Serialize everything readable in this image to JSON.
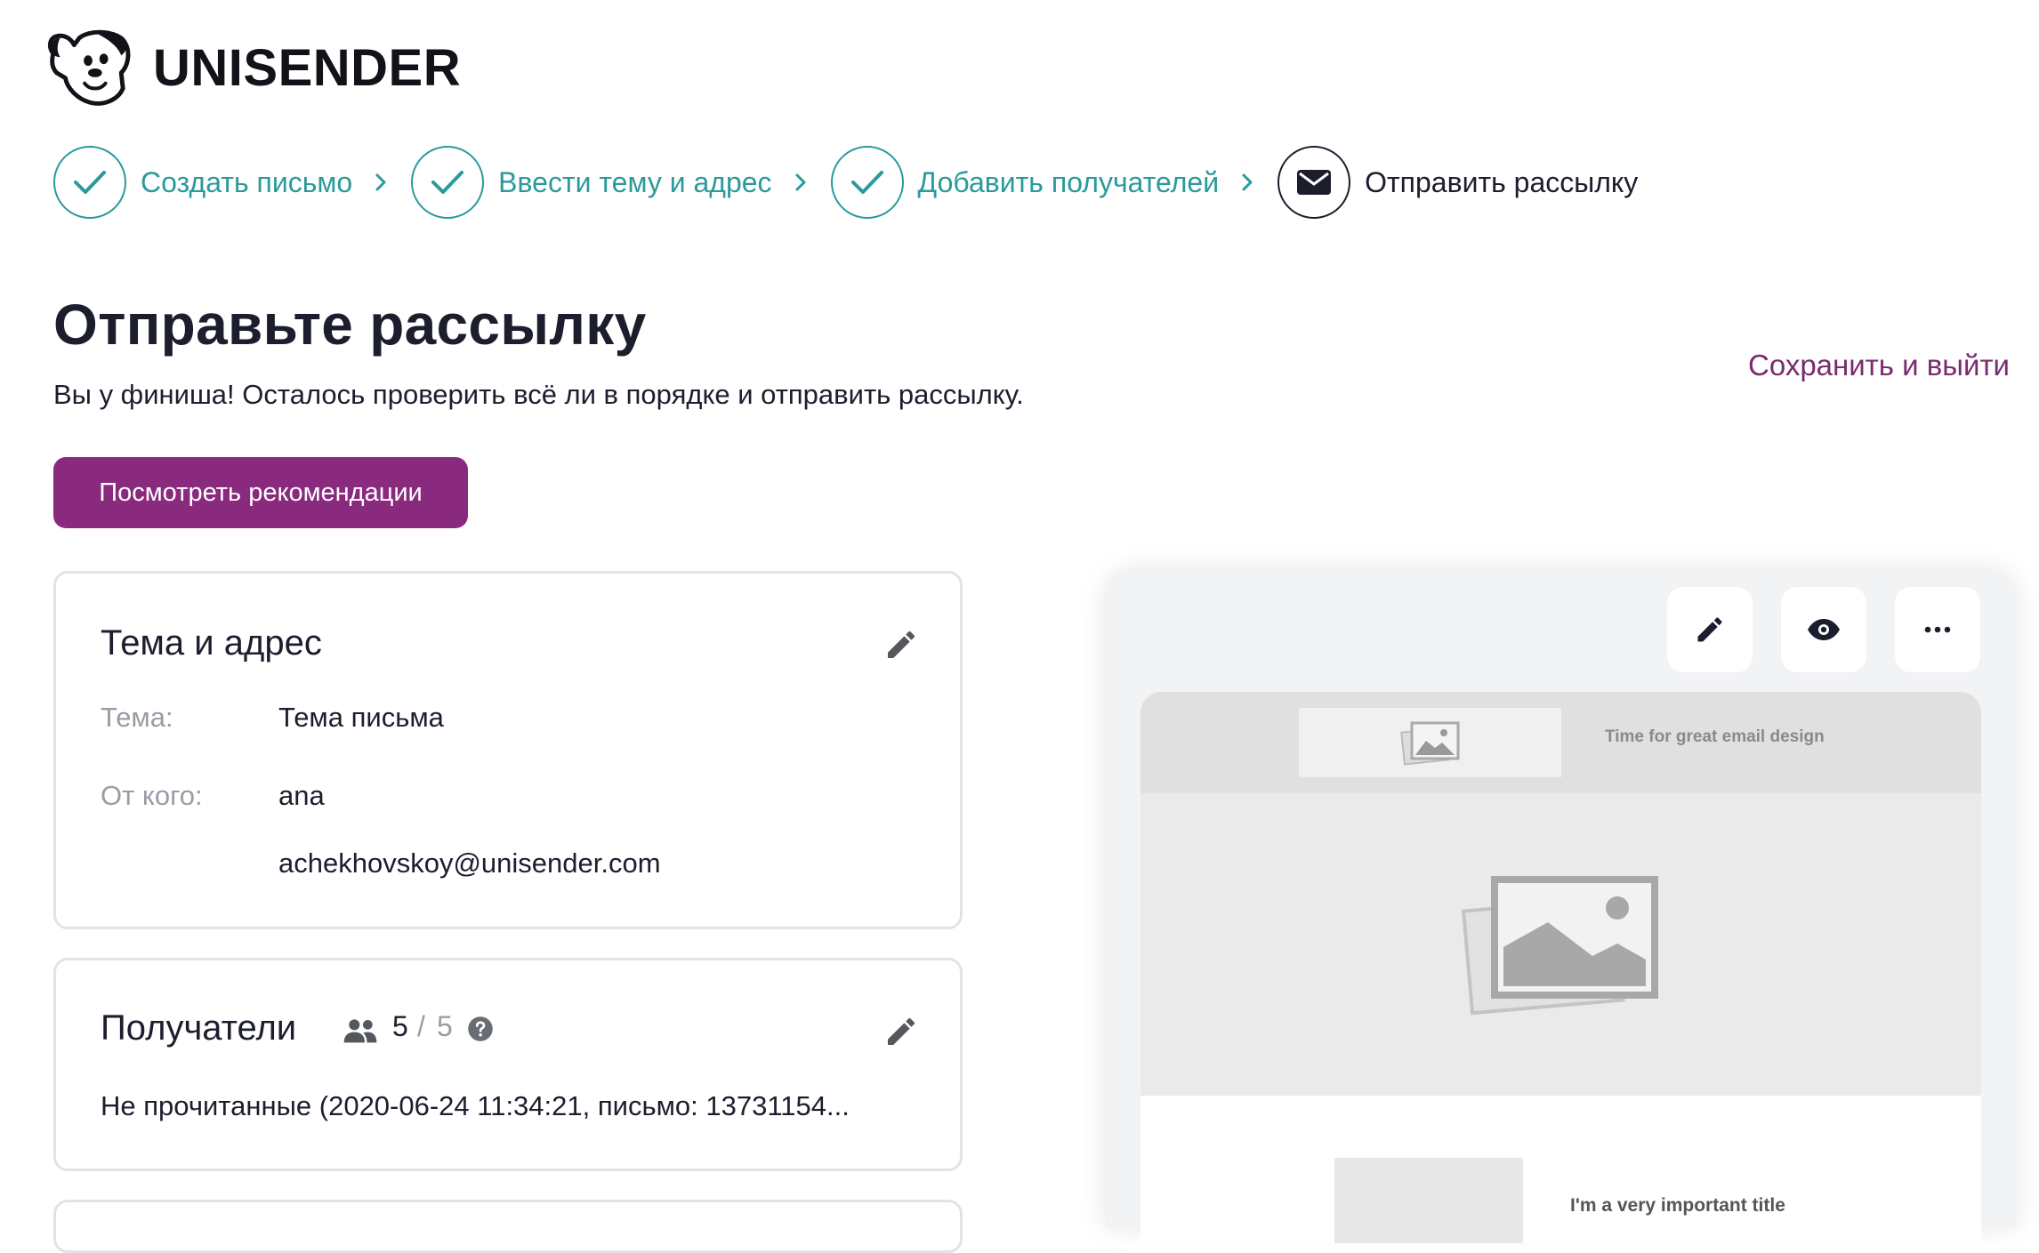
{
  "header": {
    "brand": "UNISENDER"
  },
  "stepper": {
    "steps": [
      {
        "label": "Создать письмо",
        "state": "done"
      },
      {
        "label": "Ввести тему и адрес",
        "state": "done"
      },
      {
        "label": "Добавить получателей",
        "state": "done"
      },
      {
        "label": "Отправить рассылку",
        "state": "current"
      }
    ]
  },
  "main": {
    "title": "Отправьте рассылку",
    "subtitle": "Вы у финиша! Осталось проверить всё ли в порядке и отправить рассылку.",
    "save_exit_label": "Сохранить и выйти",
    "recommendations_label": "Посмотреть рекомендации"
  },
  "subject_card": {
    "title": "Тема и адрес",
    "subject_label": "Тема:",
    "subject_value": "Тема письма",
    "from_label": "От кого:",
    "from_name": "ana",
    "from_email": "achekhovskoy@unisender.com"
  },
  "recipients_card": {
    "title": "Получатели",
    "count_current": "5",
    "count_separator": "/",
    "count_total": "5",
    "list_name": "Не прочитанные (2020-06-24 11:34:21, письмо: 13731154..."
  },
  "preview": {
    "header_text": "Time for great email design",
    "body_title": "I'm a very important title",
    "buttons": [
      "edit-icon",
      "eye-icon",
      "more-icon"
    ]
  },
  "colors": {
    "accent_teal": "#2a9a9a",
    "brand_purple": "#8a2a7e",
    "link_purple": "#7a2b6f",
    "text_dark": "#1c1e2e",
    "text_muted": "#9a9ca5"
  }
}
